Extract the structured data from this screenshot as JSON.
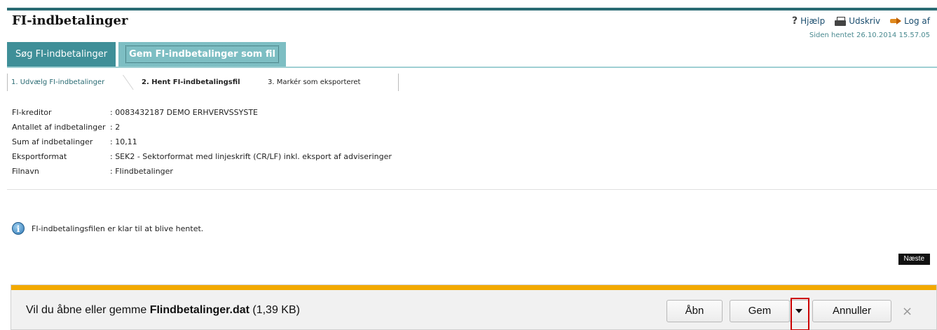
{
  "page": {
    "title": "FI-indbetalinger",
    "fetched": "Siden hentet 26.10.2014 15.57.05"
  },
  "top_links": {
    "help": "Hjælp",
    "print": "Udskriv",
    "logout": "Log af"
  },
  "tabs": [
    {
      "label": "Søg FI-indbetalinger",
      "active": false
    },
    {
      "label": "Gem FI-indbetalinger som fil",
      "active": true
    }
  ],
  "steps": [
    {
      "label": "1. Udvælg FI-indbetalinger"
    },
    {
      "label": "2. Hent FI-indbetalingsfil"
    },
    {
      "label": "3. Markér som eksporteret"
    }
  ],
  "info": [
    {
      "label": "FI-kreditor",
      "value": ": 0083432187 DEMO ERHVERVSSYSTE"
    },
    {
      "label": "Antallet af indbetalinger",
      "value": ": 2"
    },
    {
      "label": "Sum af indbetalinger",
      "value": ": 10,11"
    },
    {
      "label": "Eksportformat",
      "value": ": SEK2 - Sektorformat med linjeskrift (CR/LF) inkl. eksport af adviseringer"
    },
    {
      "label": "Filnavn",
      "value": ": FIindbetalinger"
    }
  ],
  "notice": "FI-indbetalingsfilen er klar til at blive hentet.",
  "next_button": "Næste",
  "download_bar": {
    "prefix": "Vil du åbne eller gemme ",
    "filename": "FIindbetalinger.dat",
    "size": " (1,39 KB)",
    "open": "Åbn",
    "save": "Gem",
    "cancel": "Annuller",
    "close": "×"
  },
  "colors": {
    "teal": "#3f8f98",
    "teal_active": "#7dbec3",
    "accent_bar": "#f2a900",
    "highlight": "#cc0000"
  }
}
